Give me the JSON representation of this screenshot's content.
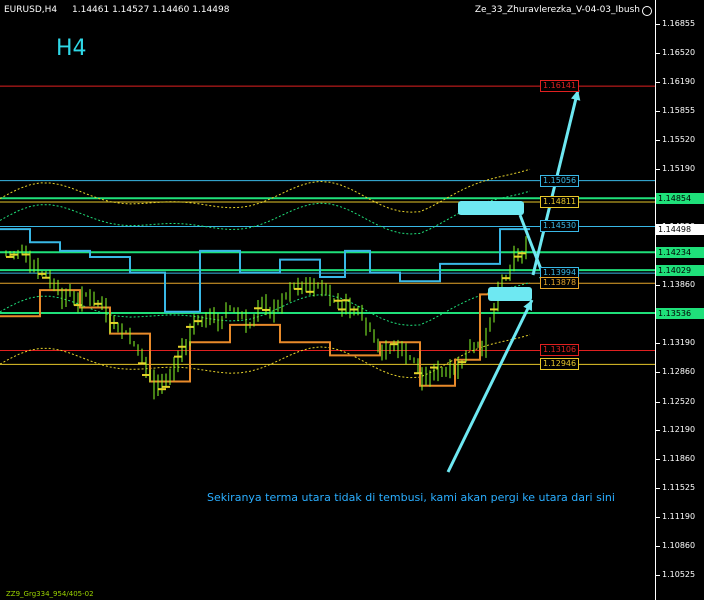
{
  "header": {
    "symbol_tf": "EURUSD,H4",
    "ohlc": "1.14461 1.14527 1.14460 1.14498",
    "ea_name": "Ze_33_Zhuravlerezka_V-04-03_Ibush"
  },
  "timeframe_label": "H4",
  "annotation_text": "Sekiranya terma utara tidak di tembusi, kami akan pergi ke utara dari sini",
  "footer_text": "ZZ9_Grg334_954/405-02",
  "icons": {
    "smiley": "smiley-face-icon"
  },
  "colors": {
    "red_level": "#e02020",
    "blue_level": "#39b8e6",
    "yellow_level": "#e6c62a",
    "green_level": "#1fe07a",
    "arrow": "#6ee8f2",
    "candle": "#8aff2a",
    "price": "#ffffff"
  },
  "price_axis": {
    "ticks": [
      "1.16855",
      "1.16520",
      "1.16190",
      "1.15855",
      "1.15520",
      "1.15190",
      "1.14855",
      "1.14520",
      "1.14190",
      "1.13860",
      "1.13525",
      "1.13190",
      "1.12860",
      "1.12520",
      "1.12190",
      "1.11860",
      "1.11525",
      "1.11190",
      "1.10860",
      "1.10525"
    ],
    "flags": [
      {
        "value": "1.14854",
        "color": "#1fe07a"
      },
      {
        "value": "1.14498",
        "color": "#ffffff"
      },
      {
        "value": "1.14234",
        "color": "#1fe07a"
      },
      {
        "value": "1.14029",
        "color": "#1fe07a"
      },
      {
        "value": "1.13536",
        "color": "#1fe07a"
      }
    ]
  },
  "levels": [
    {
      "label": "1.16141",
      "color": "#e02020"
    },
    {
      "label": "1.15056",
      "color": "#39b8e6"
    },
    {
      "label": "1.14811",
      "color": "#e6c62a"
    },
    {
      "label": "1.14530",
      "color": "#39b8e6"
    },
    {
      "label": "1.13994",
      "color": "#39b8e6"
    },
    {
      "label": "1.13878",
      "color": "#e6a52a"
    },
    {
      "label": "1.13106",
      "color": "#e02020"
    },
    {
      "label": "1.12946",
      "color": "#e6c62a"
    }
  ]
}
